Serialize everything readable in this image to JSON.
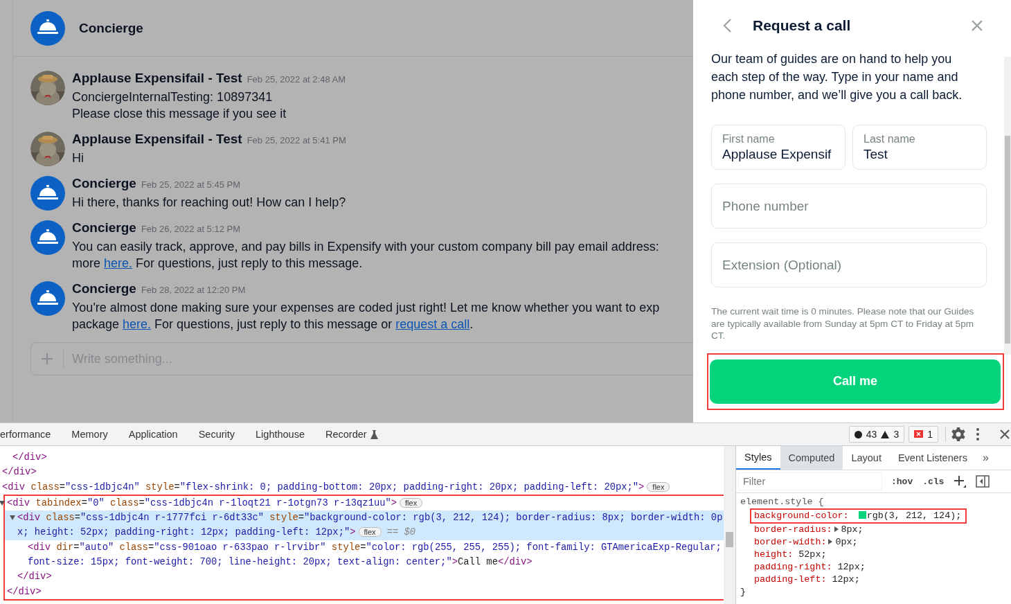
{
  "chat": {
    "header": {
      "title": "Concierge"
    },
    "messages": [
      {
        "kind": "user",
        "author": "Applause Expensifail - Test",
        "time": "Feb 25, 2022 at 2:48 AM",
        "lines": [
          [
            {
              "kind": "text",
              "text": "ConciergeInternalTesting: 10897341"
            }
          ],
          [
            {
              "kind": "text",
              "text": "Please close this message if you see it"
            }
          ]
        ]
      },
      {
        "kind": "user",
        "author": "Applause Expensifail - Test",
        "time": "Feb 25, 2022 at 5:41 PM",
        "lines": [
          [
            {
              "kind": "text",
              "text": "Hi"
            }
          ]
        ]
      },
      {
        "kind": "concierge",
        "author": "Concierge",
        "time": "Feb 25, 2022 at 5:45 PM",
        "lines": [
          [
            {
              "kind": "text",
              "text": "Hi there, thanks for reaching out! How can I help?"
            }
          ]
        ]
      },
      {
        "kind": "concierge",
        "author": "Concierge",
        "time": "Feb 26, 2022 at 5:12 PM",
        "lines": [
          [
            {
              "kind": "text",
              "text": "You can easily track, approve, and pay bills in Expensify with your custom company bill pay email address:"
            }
          ],
          [
            {
              "kind": "text",
              "text": "more "
            },
            {
              "kind": "link",
              "text": "here."
            },
            {
              "kind": "text",
              "text": " For questions, just reply to this message."
            }
          ]
        ]
      },
      {
        "kind": "concierge",
        "author": "Concierge",
        "time": "Feb 28, 2022 at 12:20 PM",
        "lines": [
          [
            {
              "kind": "text",
              "text": "You're almost done making sure your expenses are coded just right! Let me know whether you want to exp"
            }
          ],
          [
            {
              "kind": "text",
              "text": "package "
            },
            {
              "kind": "link",
              "text": "here."
            },
            {
              "kind": "text",
              "text": " For questions, just reply to this message or "
            },
            {
              "kind": "link",
              "text": "request a call"
            },
            {
              "kind": "text",
              "text": "."
            }
          ]
        ]
      }
    ],
    "composer": {
      "placeholder": "Write something..."
    }
  },
  "panel": {
    "title": "Request a call",
    "description": "Our team of guides are on hand to help you each step of the way. Type in your name and phone number, and we’ll give you a call back.",
    "field_rows": [
      [
        {
          "label": "First name",
          "value": "Applause Expensif"
        },
        {
          "label": "Last name",
          "value": "Test"
        }
      ],
      [
        {
          "placeholder": "Phone number"
        }
      ],
      [
        {
          "placeholder": "Extension (Optional)"
        }
      ]
    ],
    "note": "The current wait time is 0 minutes.  Please note that our Guides are typically available from Sunday at 5pm CT to Friday at 5pm CT.",
    "button": {
      "label": "Call me",
      "highlighted": true
    }
  },
  "devtools": {
    "tabs": [
      {
        "kind": "plain",
        "label": "erformance",
        "selected": false
      },
      {
        "kind": "plain",
        "label": "Memory",
        "selected": false
      },
      {
        "kind": "plain",
        "label": "Application",
        "selected": false
      },
      {
        "kind": "plain",
        "label": "Security",
        "selected": false
      },
      {
        "kind": "plain",
        "label": "Lighthouse",
        "selected": false
      },
      {
        "kind": "experimental",
        "label": "Recorder",
        "selected": false
      }
    ],
    "counters": [
      [
        {
          "kind": "info",
          "text": "43"
        },
        {
          "kind": "warning",
          "text": "3"
        }
      ],
      [
        {
          "kind": "error",
          "text": "1"
        }
      ]
    ],
    "tree": [
      {
        "children": [
          {
            "code": [
              {
                "kind": "tag",
                "text": "</div>"
              }
            ]
          }
        ]
      },
      {
        "code": [
          {
            "kind": "tag",
            "text": "</div>"
          }
        ]
      },
      {
        "code": [
          {
            "kind": "tag",
            "text": "<div"
          },
          {
            "kind": "attr",
            "text": " class"
          },
          {
            "kind": "pun",
            "text": "="
          },
          {
            "kind": "val",
            "text": "\"css-1dbjc4n\""
          },
          {
            "kind": "attr",
            "text": " style"
          },
          {
            "kind": "pun",
            "text": "="
          },
          {
            "kind": "val",
            "text": "\"flex-shrink: 0; padding-bottom: 20px; padding-right: 20px; padding-left: 20px;\""
          },
          {
            "kind": "tag",
            "text": ">"
          }
        ],
        "badge": "flex"
      },
      {
        "code": [
          {
            "kind": "tag",
            "text": "<div"
          },
          {
            "kind": "attr",
            "text": " tabindex"
          },
          {
            "kind": "pun",
            "text": "="
          },
          {
            "kind": "val",
            "text": "\"0\""
          },
          {
            "kind": "attr",
            "text": " class"
          },
          {
            "kind": "pun",
            "text": "="
          },
          {
            "kind": "val",
            "text": "\"css-1dbjc4n r-1loqt21 r-1otgn73 r-13qz1uu\""
          },
          {
            "kind": "tag",
            "text": ">"
          }
        ],
        "badge": "flex",
        "expanded": true,
        "selected": false,
        "highlighted": true,
        "children": [
          {
            "code": [
              {
                "kind": "tag",
                "text": "<div"
              },
              {
                "kind": "attr",
                "text": " class"
              },
              {
                "kind": "pun",
                "text": "="
              },
              {
                "kind": "val",
                "text": "\"css-1dbjc4n r-1777fci r-6dt33c\""
              },
              {
                "kind": "attr",
                "text": " style"
              },
              {
                "kind": "pun",
                "text": "="
              },
              {
                "kind": "val",
                "text": "\"background-color: rgb(3, 212, 124); border-radius: 8px; border-width: 0px; height: 52px; padding-right: 12px; padding-left: 12px;\""
              },
              {
                "kind": "tag",
                "text": ">"
              }
            ],
            "badge": "flex",
            "suffix": "== $0",
            "expanded": true,
            "selected": true,
            "children": [
              {
                "code": [
                  {
                    "kind": "tag",
                    "text": "<div"
                  },
                  {
                    "kind": "attr",
                    "text": " dir"
                  },
                  {
                    "kind": "pun",
                    "text": "="
                  },
                  {
                    "kind": "val",
                    "text": "\"auto\""
                  },
                  {
                    "kind": "attr",
                    "text": " class"
                  },
                  {
                    "kind": "pun",
                    "text": "="
                  },
                  {
                    "kind": "val",
                    "text": "\"css-901oao r-633pao r-lrvibr\""
                  },
                  {
                    "kind": "attr",
                    "text": " style"
                  },
                  {
                    "kind": "pun",
                    "text": "="
                  },
                  {
                    "kind": "val",
                    "text": "\"color: rgb(255, 255, 255); font-family: GTAmericaExp-Regular; font-size: 15px; font-weight: 700; line-height: 20px; text-align: center;\""
                  },
                  {
                    "kind": "tag",
                    "text": ">"
                  },
                  {
                    "kind": "pun",
                    "text": "Call me"
                  },
                  {
                    "kind": "tag",
                    "text": "</div>"
                  }
                ]
              }
            ],
            "close": "</div>"
          }
        ],
        "close": "</div>"
      }
    ],
    "styles": {
      "tabs": [
        {
          "label": "Styles",
          "selected": true,
          "hovered": false
        },
        {
          "label": "Computed",
          "selected": false,
          "hovered": true
        },
        {
          "label": "Layout",
          "selected": false,
          "hovered": false
        },
        {
          "label": "Event Listeners",
          "selected": false,
          "hovered": false
        }
      ],
      "overflow": "»",
      "filter": {
        "placeholder": "Filter"
      },
      "toggles": [
        ":hov",
        ".cls"
      ],
      "rule": {
        "selector": "element.style",
        "open": "{",
        "close": "}",
        "properties": [
          {
            "name": "background-color:",
            "value": "rgb(3, 212, 124);",
            "color": "#03d47c",
            "highlighted": true,
            "expandable": false
          },
          {
            "name": "border-radius:",
            "value": "8px;",
            "highlighted": false,
            "expandable": true
          },
          {
            "name": "border-width:",
            "value": "0px;",
            "highlighted": false,
            "expandable": true
          },
          {
            "name": "height:",
            "value": "52px;",
            "highlighted": false,
            "expandable": false
          },
          {
            "name": "padding-right:",
            "value": "12px;",
            "highlighted": false,
            "expandable": false
          },
          {
            "name": "padding-left:",
            "value": "12px;",
            "highlighted": false,
            "expandable": false
          }
        ]
      }
    }
  }
}
